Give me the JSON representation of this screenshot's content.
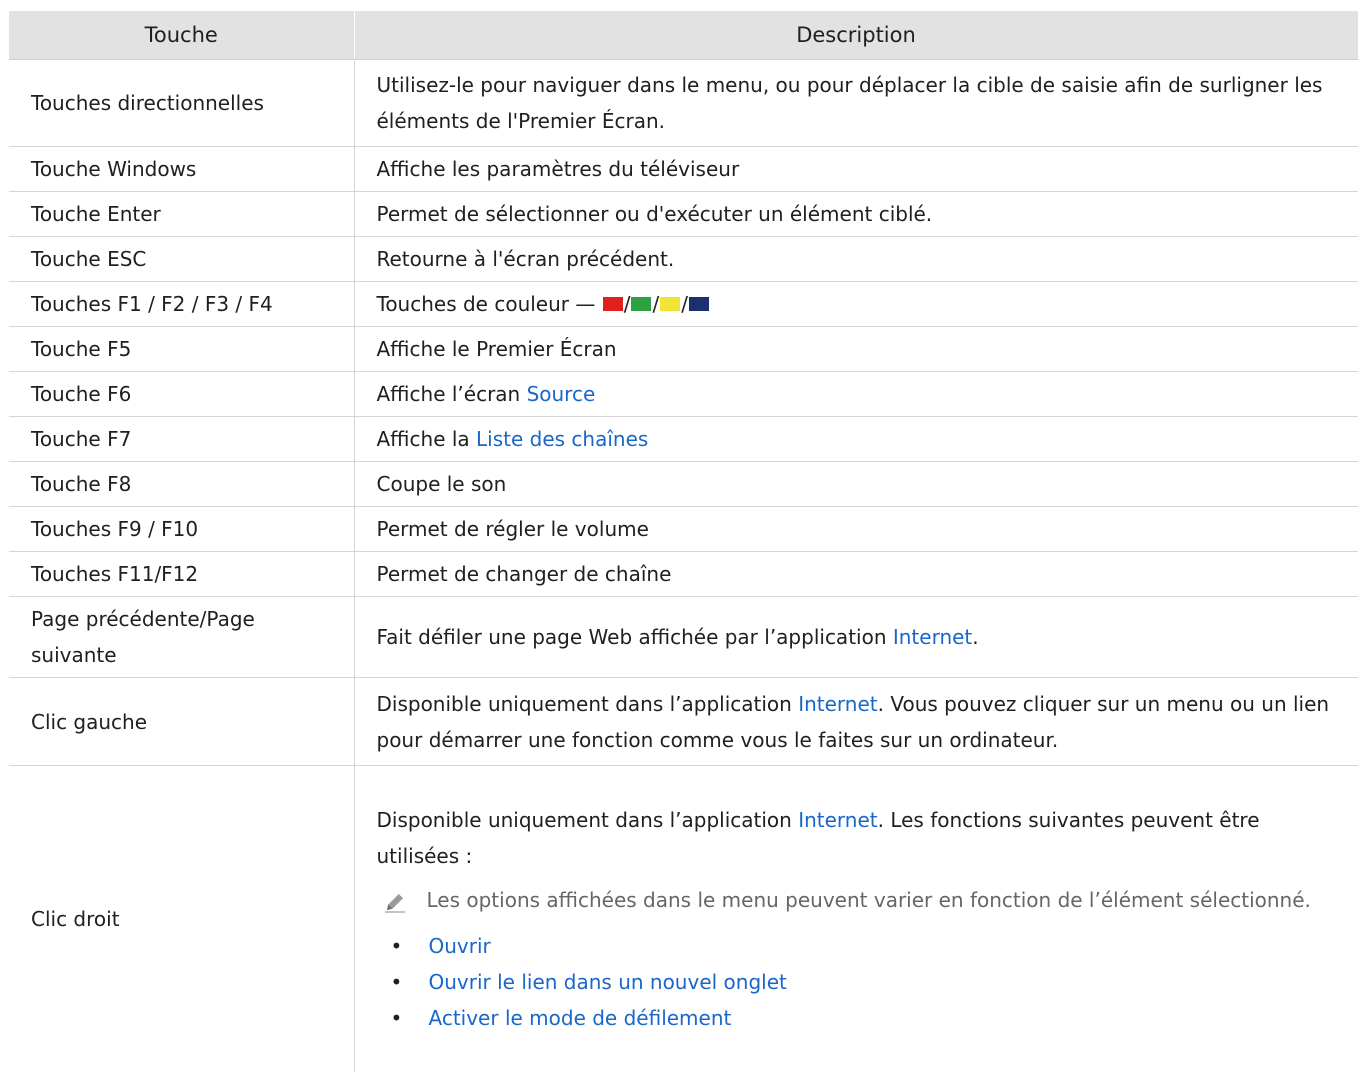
{
  "table": {
    "header": {
      "key": "Touche",
      "description": "Description"
    },
    "rows": [
      {
        "key": "Touches directionnelles",
        "desc": "Utilisez-le pour naviguer dans le menu, ou pour déplacer la cible de saisie afin de surligner les éléments de l'Premier Écran."
      },
      {
        "key": "Touche Windows",
        "desc": "Affiche les paramètres du téléviseur"
      },
      {
        "key": "Touche Enter",
        "desc": "Permet de sélectionner ou d'exécuter un élément ciblé."
      },
      {
        "key": "Touche ESC",
        "desc": "Retourne à l'écran précédent."
      },
      {
        "key": "Touches F1 / F2 / F3 / F4",
        "desc_prefix": "Touches de couleur — ",
        "separator": "/",
        "swatch_colors": [
          "#e0201b",
          "#2ea243",
          "#f3e434",
          "#1c2f6e"
        ]
      },
      {
        "key": "Touche F5",
        "desc": "Affiche le Premier Écran"
      },
      {
        "key": "Touche F6",
        "desc_prefix": "Affiche l’écran ",
        "desc_link": "Source"
      },
      {
        "key": "Touche F7",
        "desc_prefix": "Affiche la ",
        "desc_link": "Liste des chaînes"
      },
      {
        "key": "Touche F8",
        "desc": "Coupe le son"
      },
      {
        "key": "Touches F9 / F10",
        "desc": "Permet de régler le volume"
      },
      {
        "key": "Touches F11/F12",
        "desc": "Permet de changer de chaîne"
      },
      {
        "key": "Page précédente/Page suivante",
        "desc_prefix": "Fait défiler une page Web affichée par l’application ",
        "desc_link": "Internet",
        "desc_suffix": "."
      },
      {
        "key": "Clic gauche",
        "desc_prefix": "Disponible uniquement dans l’application ",
        "desc_link": "Internet",
        "desc_suffix": ". Vous pouvez cliquer sur un menu ou un lien pour démarrer une fonction comme vous le faites sur un ordinateur."
      },
      {
        "key": "Clic droit",
        "desc_prefix": "Disponible uniquement dans l’application ",
        "desc_link": "Internet",
        "desc_suffix": ". Les fonctions suivantes peuvent être utilisées :",
        "note": "Les options affichées dans le menu peuvent varier en fonction de l’élément sélectionné.",
        "note_icon": "pencil-icon",
        "bullets": [
          "Ouvrir",
          "Ouvrir le lien dans un nouvel onglet",
          "Activer le mode de défilement"
        ]
      }
    ]
  },
  "colors": {
    "header_bg": "#e2e2e2",
    "link": "#1a67c9",
    "note_text": "#666666"
  }
}
